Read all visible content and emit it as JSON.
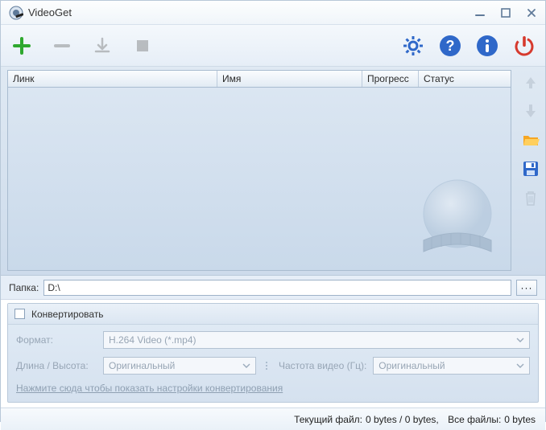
{
  "window": {
    "title": "VideoGet"
  },
  "columns": {
    "link": "Линк",
    "name": "Имя",
    "progress": "Прогресс",
    "status": "Статус"
  },
  "folder": {
    "label": "Папка:",
    "value": "D:\\"
  },
  "convert": {
    "checkbox_label": "Конвертировать",
    "format_label": "Формат:",
    "format_value": "H.264 Video (*.mp4)",
    "dims_label": "Длина / Высота:",
    "dims_value": "Оригинальный",
    "freq_label": "Частота видео (Гц):",
    "freq_value": "Оригинальный",
    "show_settings": "Нажмите сюда чтобы показать настройки конвертирования"
  },
  "status": {
    "current_label": "Текущий файл:",
    "current_value": "0 bytes / 0 bytes,",
    "all_label": "Все файлы:",
    "all_value": "0 bytes"
  }
}
